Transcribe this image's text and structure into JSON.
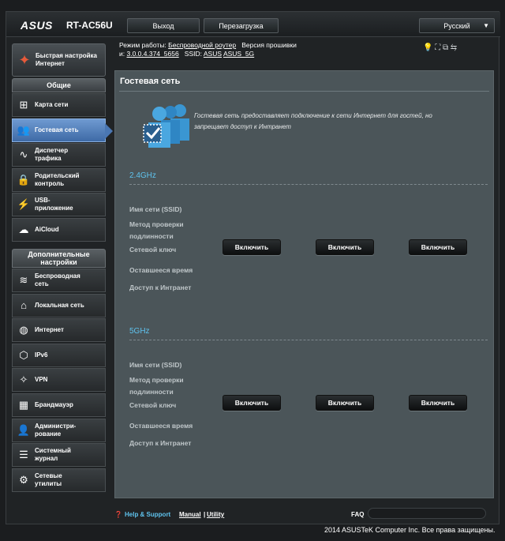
{
  "header": {
    "brand": "ASUS",
    "model": "RT-AC56U",
    "logout_label": "Выход",
    "reboot_label": "Перезагрузка",
    "language": "Русский"
  },
  "info": {
    "mode_label": "Режим работы:",
    "mode_value": "Беспроводной роутер",
    "fw_label": "Версия прошивки",
    "fw_prefix": "и:",
    "fw_value": "3.0.0.4.374_5656",
    "ssid_label": "SSID:",
    "ssid_1": "ASUS",
    "ssid_2": "ASUS_5G"
  },
  "sidebar": {
    "quick_setup": [
      "Быстрая настройка",
      "Интернет"
    ],
    "general_title": "Общие",
    "general": [
      {
        "icon": "network-map-icon",
        "label": [
          "Карта сети"
        ]
      },
      {
        "icon": "guest-network-icon",
        "label": [
          "Гостевая сеть"
        ],
        "active": true
      },
      {
        "icon": "traffic-manager-icon",
        "label": [
          "Диспетчер",
          "трафика"
        ]
      },
      {
        "icon": "parental-control-icon",
        "label": [
          "Родительский",
          "контроль"
        ]
      },
      {
        "icon": "usb-icon",
        "label": [
          "USB-",
          "приложение"
        ]
      },
      {
        "icon": "aicloud-icon",
        "label": [
          "AiCloud"
        ]
      }
    ],
    "advanced_title": [
      "Дополнительные",
      "настройки"
    ],
    "advanced": [
      {
        "icon": "wireless-icon",
        "label": [
          "Беспроводная",
          "сеть"
        ]
      },
      {
        "icon": "lan-icon",
        "label": [
          "Локальная сеть"
        ]
      },
      {
        "icon": "globe-icon",
        "label": [
          "Интернет"
        ]
      },
      {
        "icon": "ipv6-icon",
        "label": [
          "IPv6"
        ]
      },
      {
        "icon": "vpn-icon",
        "label": [
          "VPN"
        ]
      },
      {
        "icon": "firewall-icon",
        "label": [
          "Брандмауэр"
        ]
      },
      {
        "icon": "admin-icon",
        "label": [
          "Администри-",
          "рование"
        ]
      },
      {
        "icon": "syslog-icon",
        "label": [
          "Системный",
          "журнал"
        ]
      },
      {
        "icon": "tools-icon",
        "label": [
          "Сетевые",
          "утилиты"
        ]
      }
    ]
  },
  "content": {
    "title": "Гостевая сеть",
    "description": "Гостевая сеть предоставляет подключение к сети Интернет для гостей, но запрещает доступ к Интранет",
    "bands": [
      {
        "name": "2.4GHz",
        "fields": [
          "Имя сети (SSID)",
          "Метод проверки подлинности",
          "Сетевой ключ",
          "Оставшееся время",
          "Доступ к Интранет"
        ],
        "buttons": [
          "Включить",
          "Включить",
          "Включить"
        ]
      },
      {
        "name": "5GHz",
        "fields": [
          "Имя сети (SSID)",
          "Метод проверки подлинности",
          "Сетевой ключ",
          "Оставшееся время",
          "Доступ к Интранет"
        ],
        "buttons": [
          "Включить",
          "Включить",
          "Включить"
        ]
      }
    ]
  },
  "footer": {
    "help": "Help & Support",
    "manual": "Manual",
    "utility": "Utility",
    "faq": "FAQ",
    "copyright": "2014 ASUSTeK Computer Inc. Все права защищены."
  }
}
